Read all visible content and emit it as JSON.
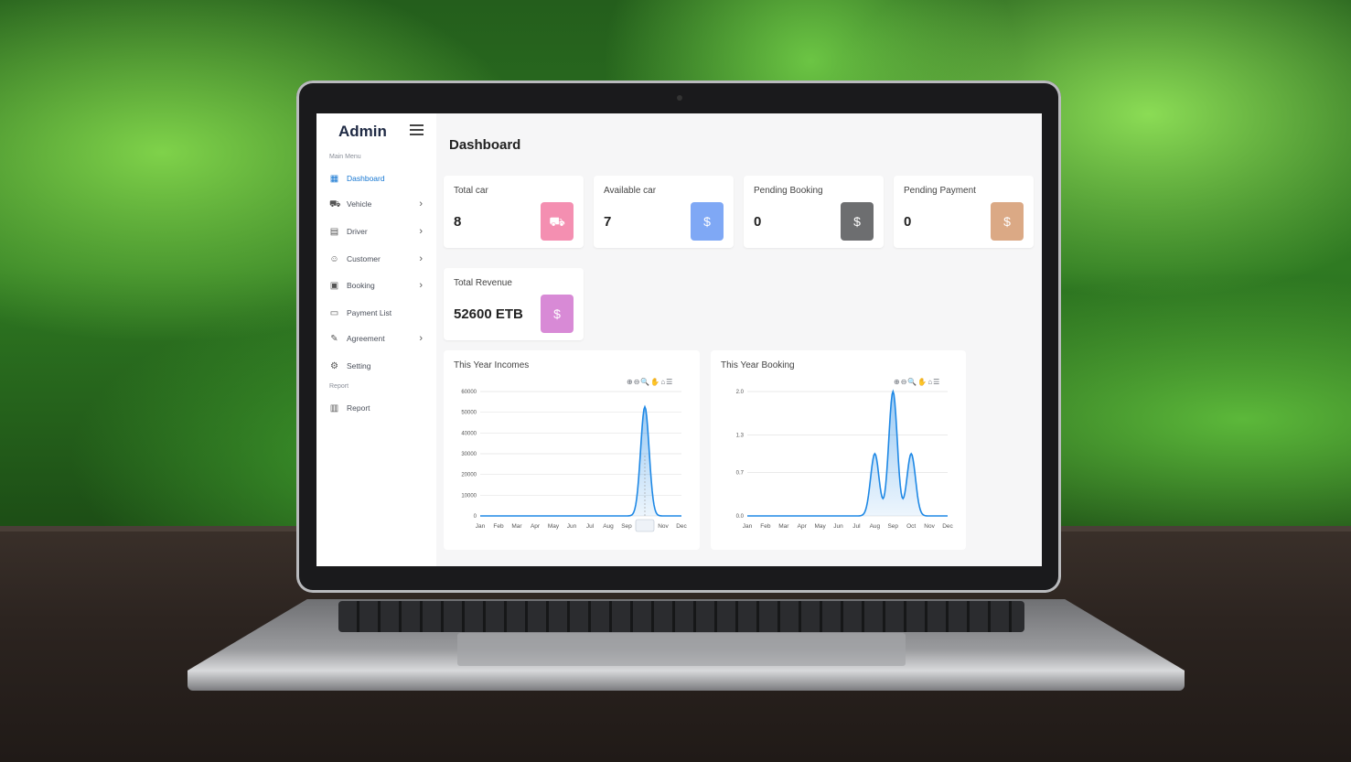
{
  "sidebar": {
    "brand": "Admin",
    "main_menu_label": "Main Menu",
    "report_label": "Report",
    "items": [
      {
        "label": "Dashboard",
        "icon": "grid-icon",
        "active": true
      },
      {
        "label": "Vehicle",
        "icon": "car-icon"
      },
      {
        "label": "Driver",
        "icon": "id-card-icon"
      },
      {
        "label": "Customer",
        "icon": "user-icon"
      },
      {
        "label": "Booking",
        "icon": "calendar-icon"
      },
      {
        "label": "Payment List",
        "icon": "money-icon"
      },
      {
        "label": "Agreement",
        "icon": "pen-icon"
      },
      {
        "label": "Setting",
        "icon": "gear-icon"
      }
    ],
    "report_item": {
      "label": "Report",
      "icon": "report-icon"
    }
  },
  "main": {
    "title": "Dashboard",
    "cards": [
      {
        "label": "Total car",
        "value": "8",
        "color": "#f48fb1",
        "icon": "car-icon"
      },
      {
        "label": "Available car",
        "value": "7",
        "color": "#7fa8f5",
        "icon": "coins-icon"
      },
      {
        "label": "Pending Booking",
        "value": "0",
        "color": "#6d6e70",
        "icon": "coins-icon"
      },
      {
        "label": "Pending Payment",
        "value": "0",
        "color": "#dba985",
        "icon": "coins-icon"
      },
      {
        "label": "Total Revenue",
        "value": "52600 ETB",
        "color": "#d88ad6",
        "icon": "coins-icon"
      }
    ]
  },
  "chart_data": [
    {
      "type": "area",
      "title": "This Year Incomes",
      "categories": [
        "Jan",
        "Feb",
        "Mar",
        "Apr",
        "May",
        "Jun",
        "Jul",
        "Aug",
        "Sep",
        "Oct",
        "Nov",
        "Dec"
      ],
      "values": [
        0,
        0,
        0,
        0,
        0,
        0,
        0,
        0,
        0,
        52600,
        0,
        0
      ],
      "ylim": [
        0,
        60000
      ],
      "yticks": [
        "60000",
        "50000",
        "40000",
        "30000",
        "20000",
        "10000",
        "0"
      ],
      "highlight": "Oct",
      "grid": true,
      "color": "#1e88e5"
    },
    {
      "type": "area",
      "title": "This Year Booking",
      "categories": [
        "Jan",
        "Feb",
        "Mar",
        "Apr",
        "May",
        "Jun",
        "Jul",
        "Aug",
        "Sep",
        "Oct",
        "Nov",
        "Dec"
      ],
      "values": [
        0,
        0,
        0,
        0,
        0,
        0,
        0,
        1,
        2,
        1,
        0,
        0
      ],
      "ylim": [
        0,
        2
      ],
      "yticks": [
        "2.0",
        "1.3",
        "0.7",
        "0.0"
      ],
      "grid": true,
      "color": "#1e88e5"
    }
  ]
}
